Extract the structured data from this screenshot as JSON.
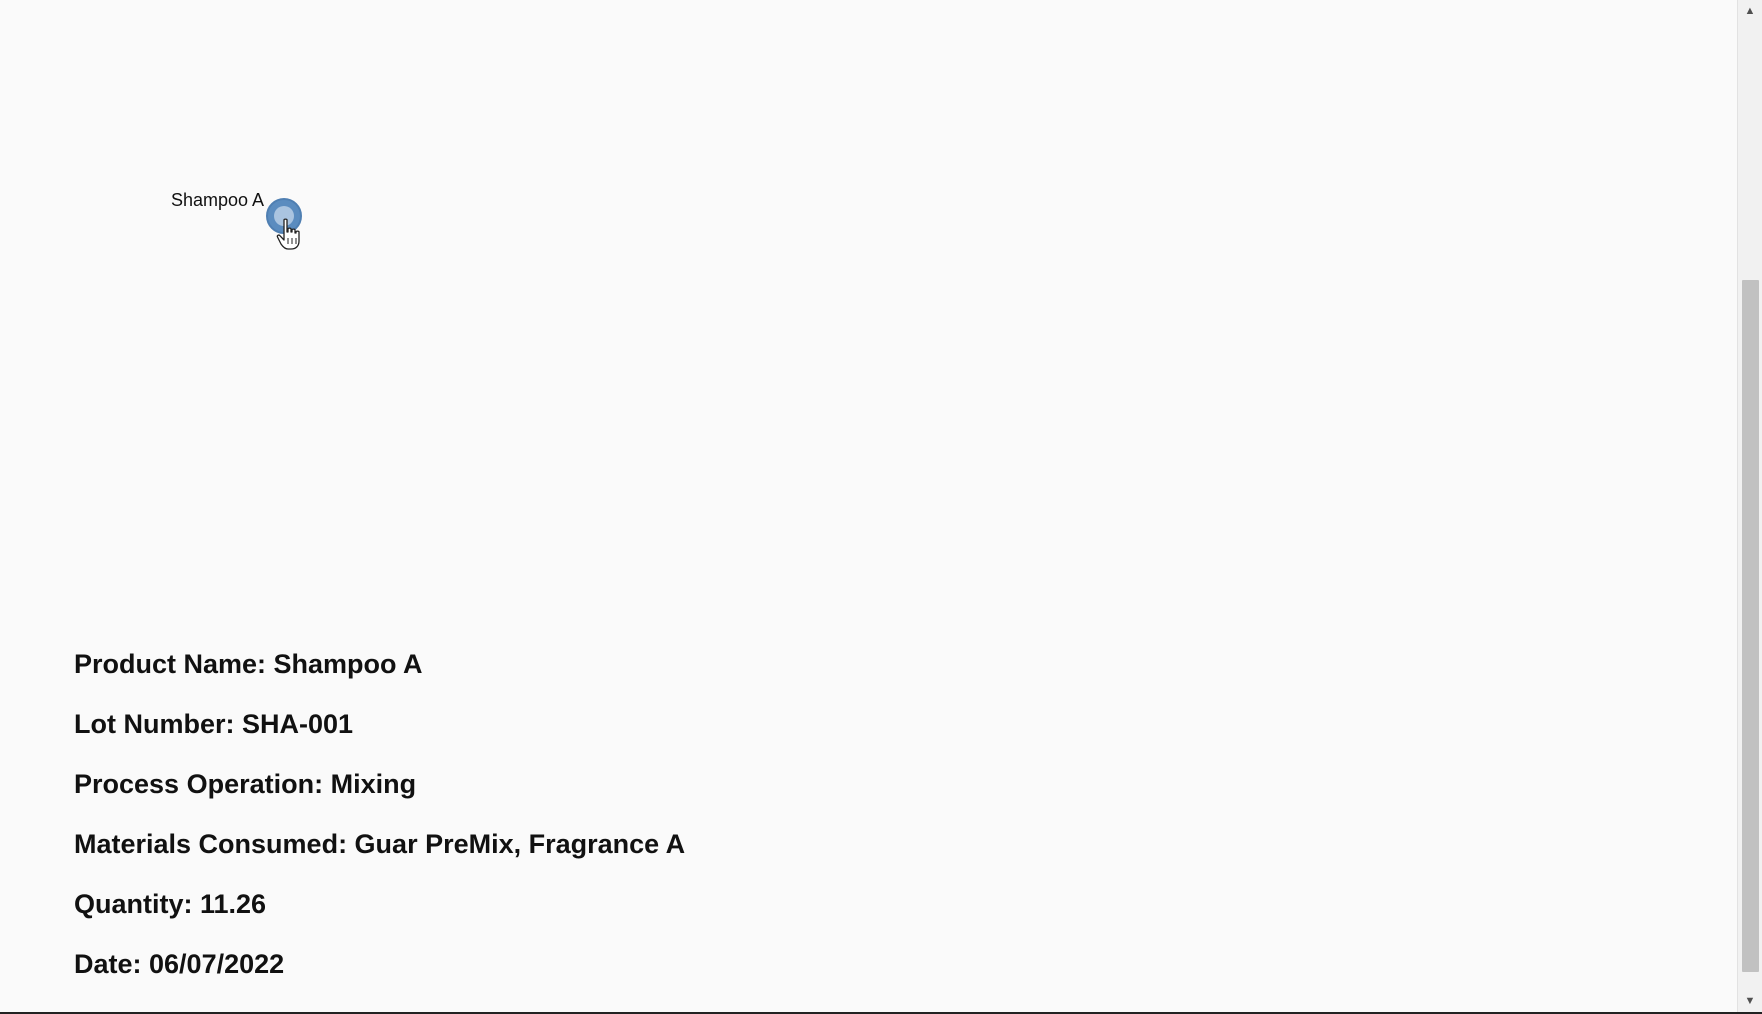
{
  "graph": {
    "node_label": "Shampoo A",
    "node_color": "#5b8cbf",
    "node_inner_color": "#aac4e0"
  },
  "details": {
    "product_name": "Product Name: Shampoo A",
    "lot_number": "Lot Number: SHA-001",
    "process_operation": "Process Operation: Mixing",
    "materials_consumed": "Materials Consumed: Guar PreMix, Fragrance A",
    "quantity": "Quantity: 11.26",
    "date": "Date: 06/07/2022"
  },
  "icons": {
    "cursor": "hand-pointer-icon",
    "scroll_up": "triangle-up-icon",
    "scroll_down": "triangle-down-icon"
  }
}
